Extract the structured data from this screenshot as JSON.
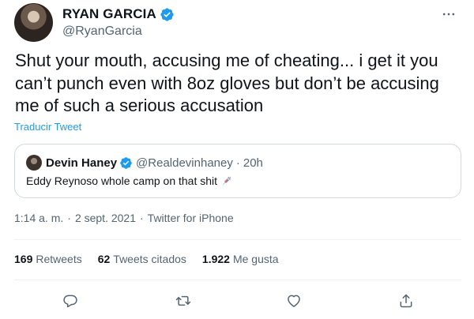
{
  "author": {
    "display_name": "RYAN GARCIA",
    "handle": "@RyanGarcia",
    "verified": true
  },
  "tweet": {
    "text": "Shut your mouth, accusing me of cheating... i get it you can’t punch even with 8oz gloves but don’t be accusing me of such a serious accusation",
    "translate_label": "Traducir Tweet"
  },
  "quote": {
    "display_name": "Devin Haney",
    "handle": "@Realdevinhaney",
    "separator": "·",
    "time": "20h",
    "text": "Eddy Reynoso whole camp on that shit"
  },
  "meta": {
    "time": "1:14 a. m.",
    "date": "2 sept. 2021",
    "source": "Twitter for iPhone",
    "separator": "·"
  },
  "stats": [
    {
      "count": "169",
      "label": "Retweets"
    },
    {
      "count": "62",
      "label": "Tweets citados"
    },
    {
      "count": "1.922",
      "label": "Me gusta"
    }
  ],
  "icons": {
    "more": "more-horizontal-icon",
    "verified": "verified-badge-icon",
    "reply": "reply-icon",
    "retweet": "retweet-icon",
    "like": "heart-icon",
    "share": "share-icon",
    "emoji": "syringe-icon"
  },
  "colors": {
    "accent": "#1d9bf0",
    "secondary_text": "#536471",
    "primary_text": "#0f1419",
    "border": "#cfd9de"
  }
}
